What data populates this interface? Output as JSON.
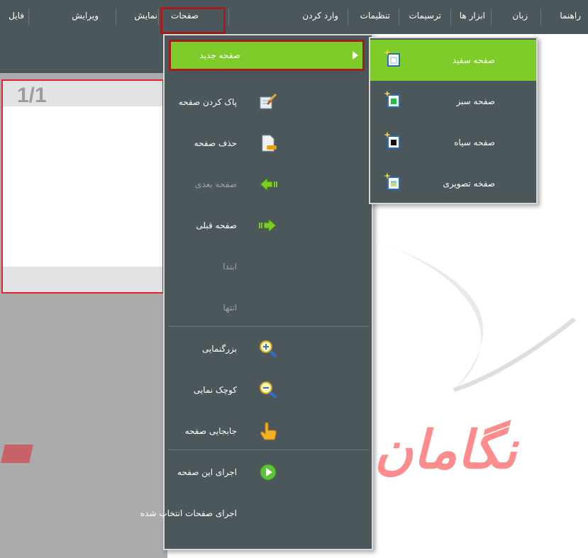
{
  "menubar": {
    "items": [
      "راهنما",
      "زبان",
      "ابزار ها",
      "ترسیمات",
      "تنظیمات",
      "وارد کردن",
      "صفحات",
      "نمایش",
      "ویرایش",
      "فایل"
    ],
    "active": "صفحات"
  },
  "canvas": {
    "page_indicator": "1/1"
  },
  "pages_menu": {
    "items": [
      {
        "label": "صفحه جدید",
        "icon": "new-page-submenu",
        "state": "highlighted",
        "has_submenu": true
      },
      {
        "label": "پاک کردن صفحه",
        "icon": "clear-page-icon",
        "state": "enabled"
      },
      {
        "label": "حذف صفحه",
        "icon": "delete-page-icon",
        "state": "enabled"
      },
      {
        "label": "صفحه بعدی",
        "icon": "green-arrow-left-icon",
        "state": "disabled"
      },
      {
        "label": "صفحه قبلی",
        "icon": "green-arrow-right-icon",
        "state": "enabled"
      },
      {
        "label": "ابتدا",
        "icon": "",
        "state": "disabled"
      },
      {
        "label": "انتها",
        "icon": "",
        "state": "disabled"
      },
      {
        "label": "بزرگنمایی",
        "icon": "zoom-in-icon",
        "state": "enabled"
      },
      {
        "label": "کوچک نمایی",
        "icon": "zoom-out-icon",
        "state": "enabled"
      },
      {
        "label": "جابجایی صفحه",
        "icon": "hand-pointer-icon",
        "state": "enabled"
      },
      {
        "label": "اجرای این صفحه",
        "icon": "play-icon",
        "state": "enabled"
      },
      {
        "label": "اجرای صفحات انتخاب شده",
        "icon": "",
        "state": "enabled"
      }
    ]
  },
  "new_page_submenu": {
    "items": [
      {
        "label": "صفحه سفید",
        "icon": "white-page-icon",
        "state": "highlighted"
      },
      {
        "label": "صفحه سبز",
        "icon": "green-page-icon",
        "state": "enabled"
      },
      {
        "label": "صفحه سیاه",
        "icon": "black-page-icon",
        "state": "enabled"
      },
      {
        "label": "صفخه تصویری",
        "icon": "image-page-icon",
        "state": "enabled"
      }
    ]
  },
  "watermark": "نگامان",
  "colors": {
    "menu_bg": "#4c575c",
    "highlight_green": "#7dcc2a",
    "annotation_red": "#a41c1c",
    "slide_border": "#e0262f"
  }
}
